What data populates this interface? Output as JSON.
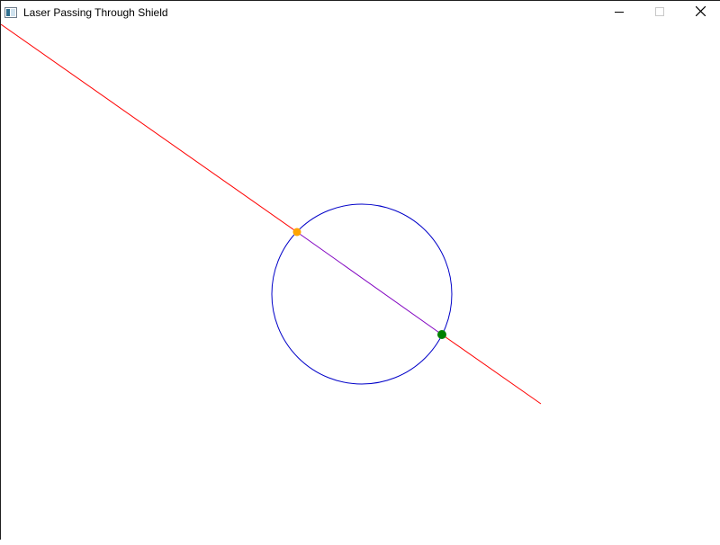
{
  "window": {
    "title": "Laser Passing Through Shield"
  },
  "controls": {
    "minimize": "minimize-icon",
    "maximize": "maximize-icon",
    "close": "close-icon"
  },
  "colors": {
    "laser": "#ff0000",
    "laser_inside_shield": "#8000c0",
    "shield": "#0000c8",
    "entry_point": "#ffa500",
    "exit_point": "#008000"
  }
}
